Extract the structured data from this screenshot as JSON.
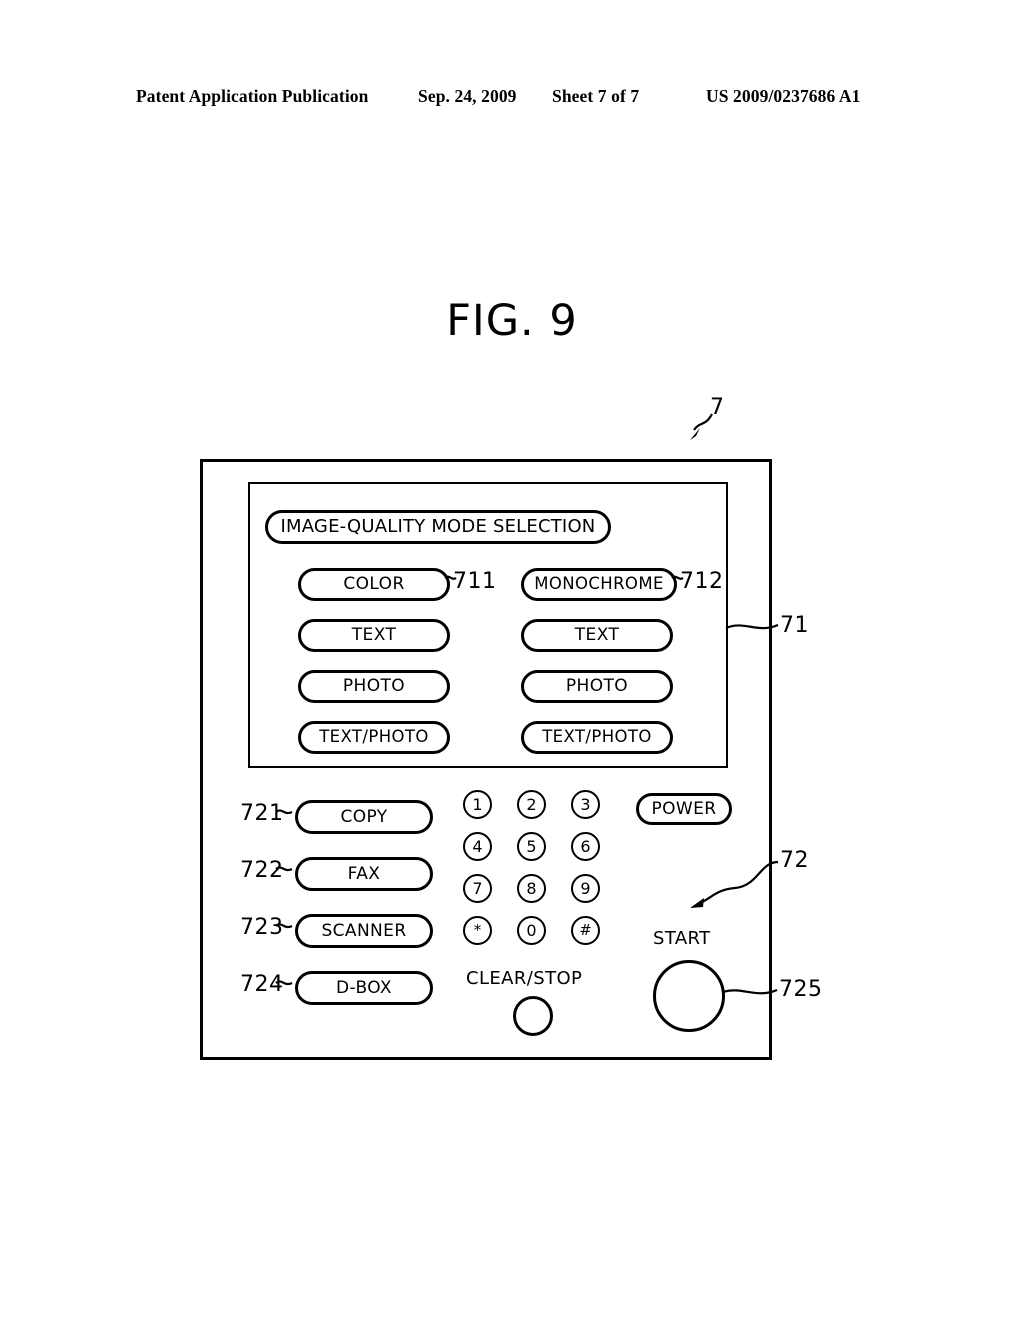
{
  "header": {
    "left": "Patent Application Publication",
    "date": "Sep. 24, 2009",
    "sheet": "Sheet 7 of 7",
    "number": "US 2009/0237686 A1"
  },
  "figure": {
    "title": "FIG. 9",
    "console_ref": "7"
  },
  "image_quality_panel": {
    "ref": "71",
    "title": "IMAGE-QUALITY MODE SELECTION",
    "columns": [
      {
        "ref": "711",
        "head": "COLOR",
        "options": [
          "TEXT",
          "PHOTO",
          "TEXT/PHOTO"
        ]
      },
      {
        "ref": "712",
        "head": "MONOCHROME",
        "options": [
          "TEXT",
          "PHOTO",
          "TEXT/PHOTO"
        ]
      }
    ]
  },
  "operation_panel": {
    "ref": "72",
    "function_buttons": [
      {
        "ref": "721",
        "label": "COPY"
      },
      {
        "ref": "722",
        "label": "FAX"
      },
      {
        "ref": "723",
        "label": "SCANNER"
      },
      {
        "ref": "724",
        "label": "D-BOX"
      }
    ],
    "power_button": "POWER",
    "keypad": {
      "rows": [
        [
          "1",
          "2",
          "3"
        ],
        [
          "4",
          "5",
          "6"
        ],
        [
          "7",
          "8",
          "9"
        ],
        [
          "*",
          "0",
          "#"
        ]
      ]
    },
    "clear_stop_label": "CLEAR/STOP",
    "start_label": "START",
    "start_ref": "725"
  }
}
